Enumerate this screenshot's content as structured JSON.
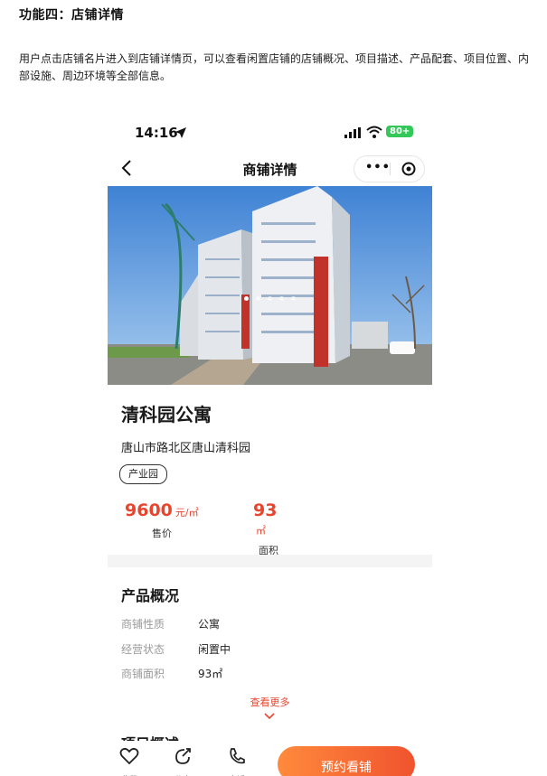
{
  "doc": {
    "title": "功能四：店铺详情",
    "description": "用户点击店铺名片进入到店铺详情页，可以查看闲置店铺的店铺概况、项目描述、产品配套、项目位置、内部设施、周边环境等全部信息。"
  },
  "status_bar": {
    "time": "14:16",
    "battery": "80+"
  },
  "nav": {
    "title": "商铺详情",
    "more_label": "•••"
  },
  "shop": {
    "name": "清科园公寓",
    "address": "唐山市路北区唐山清科园",
    "tag": "产业园",
    "price": {
      "value": "9600",
      "unit": "元/㎡",
      "label": "售价"
    },
    "area": {
      "value": "93",
      "unit": "㎡",
      "label": "面积"
    }
  },
  "overview": {
    "title": "产品概况",
    "rows": [
      {
        "key": "商铺性质",
        "value": "公寓"
      },
      {
        "key": "经营状态",
        "value": "闲置中"
      },
      {
        "key": "商铺面积",
        "value": "93㎡"
      }
    ],
    "more_label": "查看更多"
  },
  "next_section": {
    "title": "项目概述"
  },
  "bottom_bar": {
    "favorite_label": "收藏",
    "share_label": "分享",
    "phone_label": "电话",
    "book_label": "预约看铺"
  },
  "colors": {
    "accent": "#e8452e",
    "button_gradient_start": "#ff8a3c",
    "button_gradient_end": "#f0532e"
  },
  "carousel": {
    "pages": 5,
    "active": 1
  }
}
